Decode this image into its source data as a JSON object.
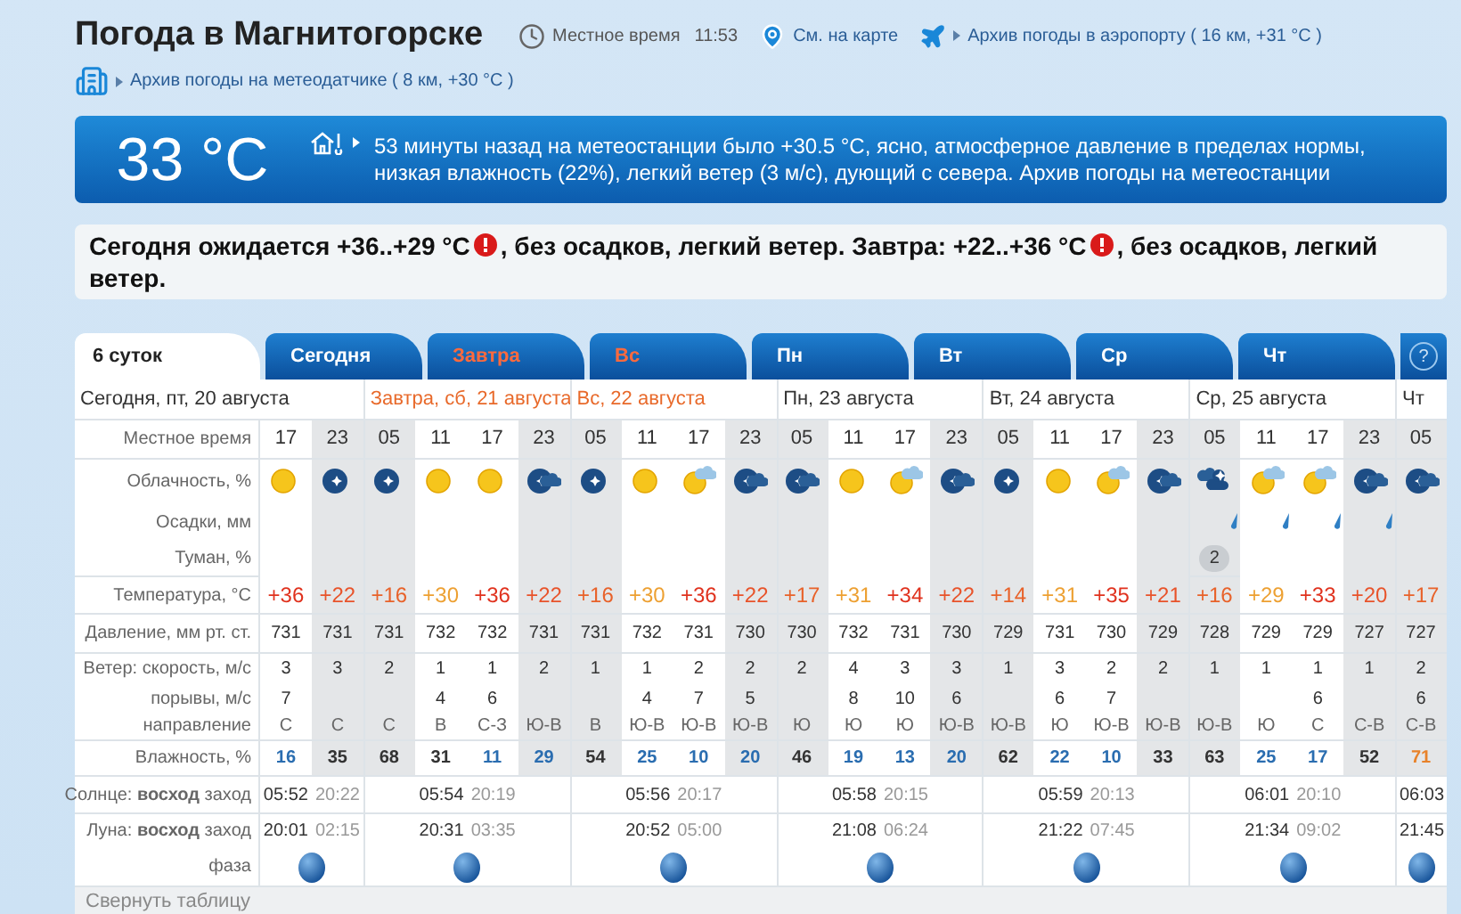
{
  "title": "Погода в Магнитогорске",
  "local_time": {
    "label": "Местное время",
    "value": "11:53"
  },
  "links": {
    "map": "См. на карте",
    "airport": "Архив погоды в аэропорту ( 16 км, +31 °C )",
    "sensor": "Архив погоды на метеодатчике ( 8 км, +30 °C )"
  },
  "current": {
    "temp": "33 °C",
    "text": "53 минуты назад на метеостанции было +30.5 °C, ясно, атмосферное давление в пределах нормы, низкая влажность (22%), легкий ветер (3 м/с), дующий с севера. Архив погоды на метеостанции"
  },
  "summary": [
    {
      "kind": "text",
      "text": "Сегодня ожидается +36..+29 °C"
    },
    {
      "kind": "alert"
    },
    {
      "kind": "text",
      "text": ", без осадков, легкий ветер. Завтра: +22..+36 °C"
    },
    {
      "kind": "alert"
    },
    {
      "kind": "text",
      "text": ", без осадков, легкий ветер."
    }
  ],
  "tabs": [
    {
      "label": "6 суток",
      "selected": true,
      "weekend": false
    },
    {
      "label": "Сегодня",
      "selected": false,
      "weekend": false
    },
    {
      "label": "Завтра",
      "selected": false,
      "weekend": true
    },
    {
      "label": "Вс",
      "selected": false,
      "weekend": true
    },
    {
      "label": "Пн",
      "selected": false,
      "weekend": false
    },
    {
      "label": "Вт",
      "selected": false,
      "weekend": false
    },
    {
      "label": "Ср",
      "selected": false,
      "weekend": false
    },
    {
      "label": "Чт",
      "selected": false,
      "weekend": false
    }
  ],
  "help": "?",
  "table": {
    "row_labels": [
      "Местное время",
      "Облачность, %",
      "Осадки, мм",
      "Туман, %",
      "Температура, °C",
      "Давление, мм рт. ст.",
      "Ветер: скорость, м/с",
      "порывы, м/с",
      "направление",
      "Влажность, %",
      "Солнце: **восход** заход",
      "Луна: **восход** заход",
      "фаза"
    ],
    "days": [
      {
        "title": "Сегодня, пт, 20 августа",
        "weekend": false,
        "sunrise": "05:52",
        "sunset": "20:22",
        "moonrise": "20:01",
        "moonset": "02:15",
        "slots": [
          {
            "time": "17",
            "night": false,
            "kind": "sun",
            "rain": false,
            "temp": {
              "text": "+36",
              "color": "#e0321e"
            },
            "pressure": "731",
            "wind": "3",
            "gust": "7",
            "dir": "С",
            "humidity": {
              "text": "16",
              "color": "#2a6db0"
            }
          },
          {
            "time": "23",
            "night": true,
            "kind": "moon",
            "rain": false,
            "temp": {
              "text": "+22",
              "color": "#e8532a"
            },
            "pressure": "731",
            "wind": "3",
            "dir": "С",
            "humidity": {
              "text": "35",
              "color": "#333333"
            }
          }
        ]
      },
      {
        "title": "Завтра, сб, 21 августа",
        "weekend": true,
        "sunrise": "05:54",
        "sunset": "20:19",
        "moonrise": "20:31",
        "moonset": "03:35",
        "slots": [
          {
            "time": "05",
            "night": true,
            "kind": "moon",
            "rain": false,
            "temp": {
              "text": "+16",
              "color": "#e8622a"
            },
            "pressure": "731",
            "wind": "2",
            "dir": "С",
            "humidity": {
              "text": "68",
              "color": "#333333"
            }
          },
          {
            "time": "11",
            "night": false,
            "kind": "sun",
            "rain": false,
            "temp": {
              "text": "+30",
              "color": "#eda032"
            },
            "pressure": "732",
            "wind": "1",
            "gust": "4",
            "dir": "В",
            "humidity": {
              "text": "31",
              "color": "#333333"
            }
          },
          {
            "time": "17",
            "night": false,
            "kind": "sun",
            "rain": false,
            "temp": {
              "text": "+36",
              "color": "#e0321e"
            },
            "pressure": "732",
            "wind": "1",
            "gust": "6",
            "dir": "С-З",
            "humidity": {
              "text": "11",
              "color": "#2a6db0"
            }
          },
          {
            "time": "23",
            "night": true,
            "kind": "moon_cloud",
            "rain": false,
            "temp": {
              "text": "+22",
              "color": "#e8532a"
            },
            "pressure": "731",
            "wind": "2",
            "dir": "Ю-В",
            "humidity": {
              "text": "29",
              "color": "#2a6db0"
            }
          }
        ]
      },
      {
        "title": "Вс, 22 августа",
        "weekend": true,
        "sunrise": "05:56",
        "sunset": "20:17",
        "moonrise": "20:52",
        "moonset": "05:00",
        "slots": [
          {
            "time": "05",
            "night": true,
            "kind": "moon",
            "rain": false,
            "temp": {
              "text": "+16",
              "color": "#e8622a"
            },
            "pressure": "731",
            "wind": "1",
            "dir": "В",
            "humidity": {
              "text": "54",
              "color": "#333333"
            }
          },
          {
            "time": "11",
            "night": false,
            "kind": "sun",
            "rain": false,
            "temp": {
              "text": "+30",
              "color": "#eda032"
            },
            "pressure": "732",
            "wind": "1",
            "gust": "4",
            "dir": "Ю-В",
            "humidity": {
              "text": "25",
              "color": "#2a6db0"
            }
          },
          {
            "time": "17",
            "night": false,
            "kind": "sun_cloud",
            "rain": false,
            "temp": {
              "text": "+36",
              "color": "#e0321e"
            },
            "pressure": "731",
            "wind": "2",
            "gust": "7",
            "dir": "Ю-В",
            "humidity": {
              "text": "10",
              "color": "#2a6db0"
            }
          },
          {
            "time": "23",
            "night": true,
            "kind": "moon_cloud",
            "rain": false,
            "temp": {
              "text": "+22",
              "color": "#e8532a"
            },
            "pressure": "730",
            "wind": "2",
            "gust": "5",
            "dir": "Ю-В",
            "humidity": {
              "text": "20",
              "color": "#2a6db0"
            }
          }
        ]
      },
      {
        "title": "Пн, 23 августа",
        "weekend": false,
        "sunrise": "05:58",
        "sunset": "20:15",
        "moonrise": "21:08",
        "moonset": "06:24",
        "slots": [
          {
            "time": "05",
            "night": true,
            "kind": "moon_cloud",
            "rain": false,
            "temp": {
              "text": "+17",
              "color": "#e8622a"
            },
            "pressure": "730",
            "wind": "2",
            "dir": "Ю",
            "humidity": {
              "text": "46",
              "color": "#333333"
            }
          },
          {
            "time": "11",
            "night": false,
            "kind": "sun",
            "rain": false,
            "temp": {
              "text": "+31",
              "color": "#eda032"
            },
            "pressure": "732",
            "wind": "4",
            "gust": "8",
            "dir": "Ю",
            "humidity": {
              "text": "19",
              "color": "#2a6db0"
            }
          },
          {
            "time": "17",
            "night": false,
            "kind": "sun_cloud",
            "rain": false,
            "temp": {
              "text": "+34",
              "color": "#e0321e"
            },
            "pressure": "731",
            "wind": "3",
            "gust": "10",
            "dir": "Ю",
            "humidity": {
              "text": "13",
              "color": "#2a6db0"
            }
          },
          {
            "time": "23",
            "night": true,
            "kind": "moon_cloud",
            "rain": false,
            "temp": {
              "text": "+22",
              "color": "#e8532a"
            },
            "pressure": "730",
            "wind": "3",
            "gust": "6",
            "dir": "Ю-В",
            "humidity": {
              "text": "20",
              "color": "#2a6db0"
            }
          }
        ]
      },
      {
        "title": "Вт, 24 августа",
        "weekend": false,
        "sunrise": "05:59",
        "sunset": "20:13",
        "moonrise": "21:22",
        "moonset": "07:45",
        "slots": [
          {
            "time": "05",
            "night": true,
            "kind": "moon",
            "rain": false,
            "temp": {
              "text": "+14",
              "color": "#e8622a"
            },
            "pressure": "729",
            "wind": "1",
            "dir": "Ю-В",
            "humidity": {
              "text": "62",
              "color": "#333333"
            }
          },
          {
            "time": "11",
            "night": false,
            "kind": "sun",
            "rain": false,
            "temp": {
              "text": "+31",
              "color": "#eda032"
            },
            "pressure": "731",
            "wind": "3",
            "gust": "6",
            "dir": "Ю",
            "humidity": {
              "text": "22",
              "color": "#2a6db0"
            }
          },
          {
            "time": "17",
            "night": false,
            "kind": "sun_cloud",
            "rain": false,
            "temp": {
              "text": "+35",
              "color": "#e0321e"
            },
            "pressure": "730",
            "wind": "2",
            "gust": "7",
            "dir": "Ю-В",
            "humidity": {
              "text": "10",
              "color": "#2a6db0"
            }
          },
          {
            "time": "23",
            "night": true,
            "kind": "moon_cloud",
            "rain": false,
            "temp": {
              "text": "+21",
              "color": "#e8532a"
            },
            "pressure": "729",
            "wind": "2",
            "dir": "Ю-В",
            "humidity": {
              "text": "33",
              "color": "#333333"
            }
          }
        ]
      },
      {
        "title": "Ср, 25 августа",
        "weekend": false,
        "sunrise": "06:01",
        "sunset": "20:10",
        "moonrise": "21:34",
        "moonset": "09:02",
        "slots": [
          {
            "time": "05",
            "night": true,
            "kind": "overcast",
            "rain": true,
            "fog": "2",
            "temp": {
              "text": "+16",
              "color": "#e8622a"
            },
            "pressure": "728",
            "wind": "1",
            "dir": "Ю-В",
            "humidity": {
              "text": "63",
              "color": "#333333"
            }
          },
          {
            "time": "11",
            "night": false,
            "kind": "sun_cloud",
            "rain": true,
            "temp": {
              "text": "+29",
              "color": "#eda032"
            },
            "pressure": "729",
            "wind": "1",
            "dir": "Ю",
            "humidity": {
              "text": "25",
              "color": "#2a6db0"
            }
          },
          {
            "time": "17",
            "night": false,
            "kind": "sun_cloud",
            "rain": true,
            "temp": {
              "text": "+33",
              "color": "#e0321e"
            },
            "pressure": "729",
            "wind": "1",
            "gust": "6",
            "dir": "С",
            "humidity": {
              "text": "17",
              "color": "#2a6db0"
            }
          },
          {
            "time": "23",
            "night": true,
            "kind": "moon_cloud",
            "rain": true,
            "temp": {
              "text": "+20",
              "color": "#e8532a"
            },
            "pressure": "727",
            "wind": "1",
            "dir": "С-В",
            "humidity": {
              "text": "52",
              "color": "#333333"
            }
          }
        ]
      },
      {
        "title": "Чт",
        "weekend": false,
        "sunrise": "06:03",
        "moonrise": "21:45",
        "slots": [
          {
            "time": "05",
            "night": true,
            "kind": "moon_cloud",
            "rain": false,
            "temp": {
              "text": "+17",
              "color": "#e8622a"
            },
            "pressure": "727",
            "wind": "2",
            "gust": "6",
            "dir": "С-В",
            "humidity": {
              "text": "71",
              "color": "#e8822a"
            }
          }
        ]
      }
    ],
    "collapse": "Свернуть таблицу"
  }
}
